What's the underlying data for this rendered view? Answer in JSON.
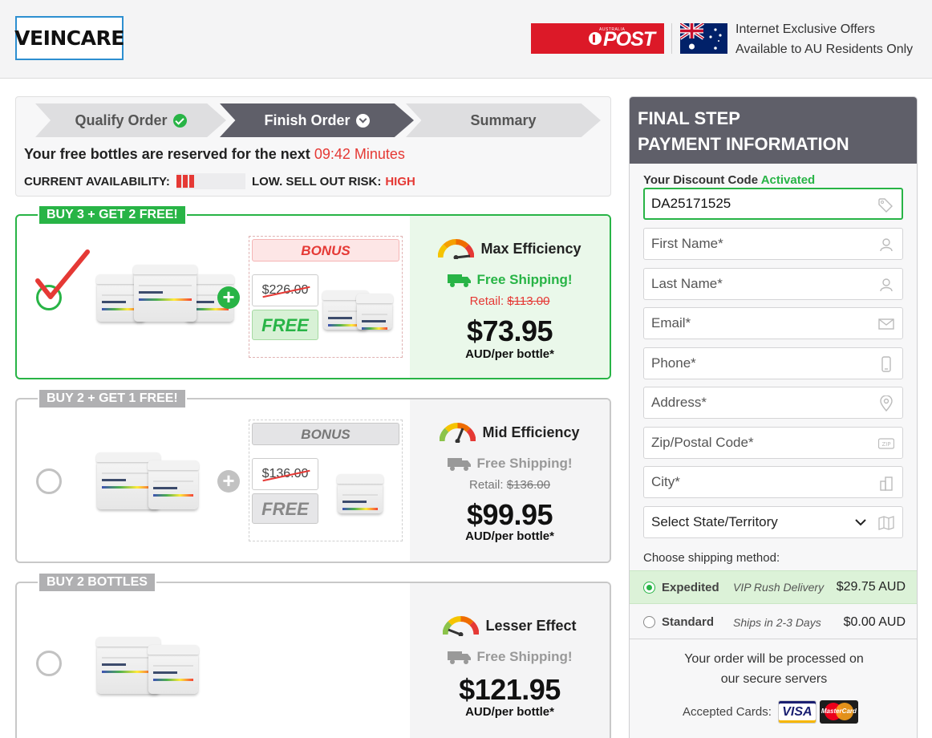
{
  "header": {
    "logo": "VEINCARE",
    "post_small": "AUSTRALIA",
    "post_word": "POST",
    "offer_line1": "Internet Exclusive Offers",
    "offer_line2": "Available to AU Residents Only"
  },
  "steps": {
    "items": [
      {
        "label": "Qualify Order",
        "icon": "check-circle-icon"
      },
      {
        "label": "Finish Order",
        "icon": "arrow-down-circle-icon"
      },
      {
        "label": "Summary",
        "icon": ""
      }
    ],
    "reserve_text": "Your free bottles are reserved for the next",
    "timer": "09:42 Minutes",
    "availability_label": "CURRENT AVAILABILITY:",
    "risk_label": "LOW. SELL OUT RISK:",
    "risk_value": "HIGH",
    "availability_level": 0.3
  },
  "offers": [
    {
      "tag": "BUY 3 + GET 2 FREE!",
      "selected": true,
      "bonus_title": "BONUS",
      "bonus_old_price": "$226.00",
      "bonus_free": "FREE",
      "efficiency": "Max Efficiency",
      "shipping": "Free Shipping!",
      "retail_label": "Retail:",
      "retail_price": "$113.00",
      "price": "$73.95",
      "per": "AUD/per bottle*"
    },
    {
      "tag": "BUY 2 + GET 1 FREE!",
      "selected": false,
      "bonus_title": "BONUS",
      "bonus_old_price": "$136.00",
      "bonus_free": "FREE",
      "efficiency": "Mid Efficiency",
      "shipping": "Free Shipping!",
      "retail_label": "Retail:",
      "retail_price": "$136.00",
      "price": "$99.95",
      "per": "AUD/per bottle*"
    },
    {
      "tag": "BUY 2 BOTTLES",
      "selected": false,
      "efficiency": "Lesser Effect",
      "shipping": "Free Shipping!",
      "price": "$121.95",
      "per": "AUD/per bottle*"
    }
  ],
  "panel": {
    "title_line1": "FINAL STEP",
    "title_line2": "PAYMENT INFORMATION",
    "discount_label": "Your Discount Code",
    "discount_status": "Activated",
    "discount_code": "DA25171525",
    "fields": {
      "first_name": "First Name*",
      "last_name": "Last Name*",
      "email": "Email*",
      "phone": "Phone*",
      "address": "Address*",
      "zip": "Zip/Postal Code*",
      "city": "City*",
      "state": "Select State/Territory"
    },
    "shipping_label": "Choose shipping method:",
    "shipping_options": [
      {
        "name": "Expedited",
        "desc": "VIP Rush Delivery",
        "price": "$29.75 AUD",
        "selected": true
      },
      {
        "name": "Standard",
        "desc": "Ships in 2-3 Days",
        "price": "$0.00 AUD",
        "selected": false
      }
    ],
    "secure_line1": "Your order will be processed on",
    "secure_line2": "our secure servers",
    "cards_label": "Accepted Cards:",
    "card_visa": "VISA",
    "card_mc": "MasterCard"
  },
  "colors": {
    "accent_green": "#28b446",
    "alert_red": "#e53935",
    "dark_grey": "#5f5f69"
  }
}
